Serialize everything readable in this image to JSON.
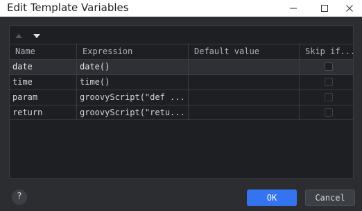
{
  "window": {
    "title": "Edit Template Variables"
  },
  "toolbar": {
    "move_up_icon": "triangle-up-icon",
    "move_down_icon": "triangle-down-icon"
  },
  "table": {
    "headers": [
      "Name",
      "Expression",
      "Default value",
      "Skip if..."
    ],
    "rows": [
      {
        "name": "date",
        "expression": "date()",
        "default_value": "",
        "skip": false,
        "selected": true
      },
      {
        "name": "time",
        "expression": "time()",
        "default_value": "",
        "skip": false,
        "selected": false
      },
      {
        "name": "param",
        "expression": "groovyScript(\"def ...",
        "default_value": "",
        "skip": false,
        "selected": false
      },
      {
        "name": "return",
        "expression": "groovyScript(\"retu...",
        "default_value": "",
        "skip": false,
        "selected": false
      }
    ]
  },
  "footer": {
    "help_label": "?",
    "ok_label": "OK",
    "cancel_label": "Cancel"
  },
  "colors": {
    "accent": "#3574f0",
    "background": "#2b2d30",
    "panel": "#1e1f22"
  }
}
